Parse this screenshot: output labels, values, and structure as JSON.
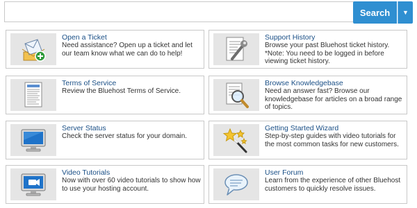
{
  "search": {
    "placeholder": "",
    "button_label": "Search",
    "dropdown_glyph": "▼"
  },
  "cards": [
    {
      "title": "Open a Ticket",
      "description": "Need assistance? Open up a ticket and let our team know what we can do to help!",
      "icon": "envelope-plus-icon"
    },
    {
      "title": "Support History",
      "description": "Browse your past Bluehost ticket history. *Note: You need to be logged in before viewing ticket history.",
      "icon": "document-wrench-icon"
    },
    {
      "title": "Terms of Service",
      "description": "Review the Bluehost Terms of Service.",
      "icon": "document-icon"
    },
    {
      "title": "Browse Knowledgebase",
      "description": "Need an answer fast? Browse our knowledgebase for articles on a broad range of topics.",
      "icon": "magnifier-document-icon"
    },
    {
      "title": "Server Status",
      "description": "Check the server status for your domain.",
      "icon": "monitor-icon"
    },
    {
      "title": "Getting Started Wizard",
      "description": "Step-by-step guides with video tutorials for the most common tasks for new customers.",
      "icon": "wand-stars-icon"
    },
    {
      "title": "Video Tutorials",
      "description": "Now with over 60 video tutorials to show how to use your hosting account.",
      "icon": "monitor-video-icon"
    },
    {
      "title": "User Forum",
      "description": "Learn from the experience of other Bluehost customers to quickly resolve issues.",
      "icon": "speech-bubble-icon"
    }
  ],
  "colors": {
    "accent": "#2f8fd1",
    "title_link": "#1a4f86",
    "icon_bg": "#e5e5e5",
    "card_border": "#c8c8c8"
  }
}
